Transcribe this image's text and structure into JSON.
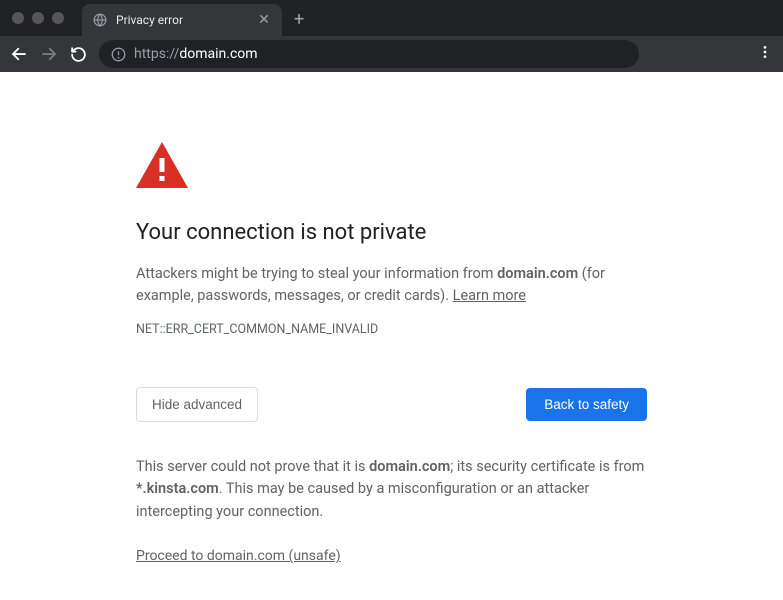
{
  "tab": {
    "title": "Privacy error"
  },
  "address": {
    "protocol": "https://",
    "domain": "domain.com"
  },
  "page": {
    "headline": "Your connection is not private",
    "desc_prefix": "Attackers might be trying to steal your information from ",
    "desc_domain": "domain.com",
    "desc_suffix": " (for example, passwords, messages, or credit cards). ",
    "learn_more": "Learn more",
    "error_code": "NET::ERR_CERT_COMMON_NAME_INVALID",
    "hide_advanced": "Hide advanced",
    "back_to_safety": "Back to safety",
    "details_prefix": "This server could not prove that it is ",
    "details_domain": "domain.com",
    "details_mid": "; its security certificate is from ",
    "details_cert": "*.kinsta.com",
    "details_suffix": ". This may be caused by a misconfiguration or an attacker intercepting your connection.",
    "proceed": "Proceed to domain.com (unsafe)"
  }
}
